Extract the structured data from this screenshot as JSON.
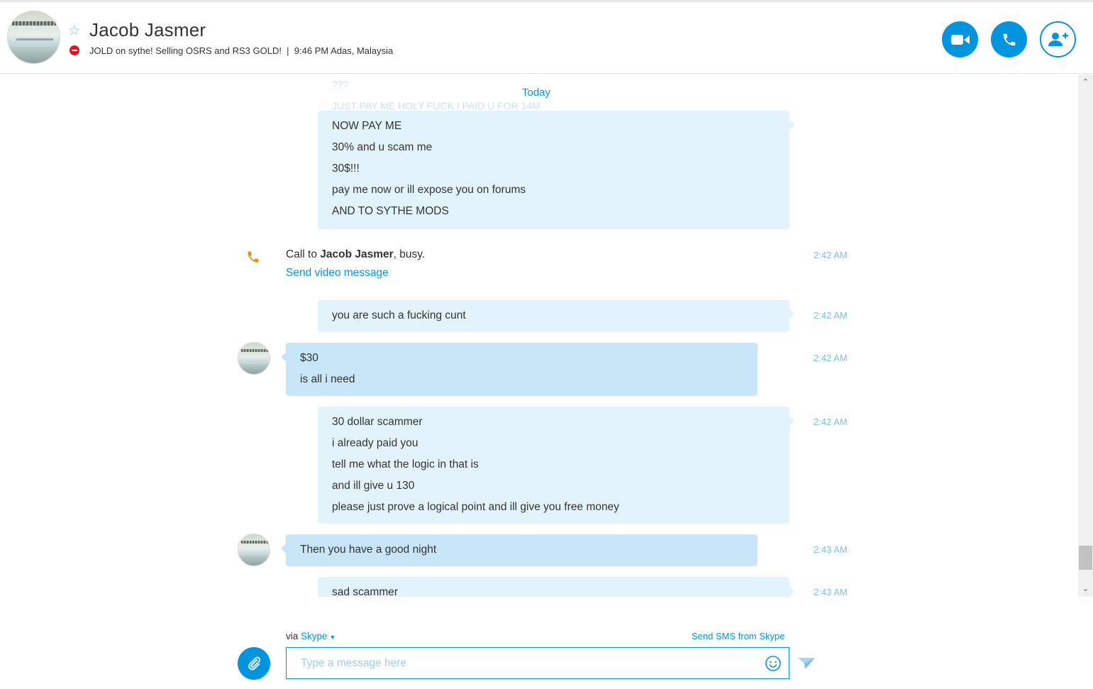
{
  "header": {
    "contact_name": "Jacob Jasmer",
    "mood": "JOLD on sythe! Selling OSRS and RS3 GOLD!  |  9:46 PM Adas, Malaysia",
    "status": "do-not-disturb",
    "buttons": {
      "video": "video-call",
      "audio": "audio-call",
      "add": "add-people"
    }
  },
  "chat": {
    "faded_lines": [
      "???",
      "JUST PAY ME HOLY FUCK I PAID U FOR 14M"
    ],
    "date_divider": "Today",
    "messages": [
      {
        "lines": [
          "NOW PAY ME",
          "30% and u scam me",
          "30$!!!",
          "pay me now or ill expose you on forums",
          "AND TO SYTHE MODS"
        ],
        "time": ""
      },
      {
        "lines": [
          "you are such a fucking cunt"
        ],
        "time": "2:42 AM"
      },
      {
        "lines": [
          "$30",
          "is all i need"
        ],
        "time": "2:42 AM"
      },
      {
        "lines": [
          "30 dollar scammer",
          "i already paid you",
          "tell me what the logic in that is",
          "and ill give u 130",
          "please just prove a logical point and ill give you free money"
        ],
        "time": "2:42 AM"
      },
      {
        "lines": [
          "Then you have a good night"
        ],
        "time": "2:43 AM"
      },
      {
        "lines": [
          "sad scammer"
        ],
        "time": "2:43 AM"
      }
    ],
    "call": {
      "prefix": "Call to ",
      "name": "Jacob Jasmer",
      "suffix": ", busy.",
      "link": "Send video message",
      "time": "2:42 AM"
    }
  },
  "composer": {
    "via_label": "via ",
    "via_service": "Skype",
    "sms_link": "Send SMS from Skype",
    "placeholder": "Type a message here"
  },
  "colors": {
    "accent": "#0095de",
    "outgoing_bubble": "#e3f3fb",
    "incoming_bubble": "#c7e7f8",
    "timestamp": "#7bbfe5",
    "status_dnd": "#e81123",
    "call_icon": "#f28c00"
  }
}
